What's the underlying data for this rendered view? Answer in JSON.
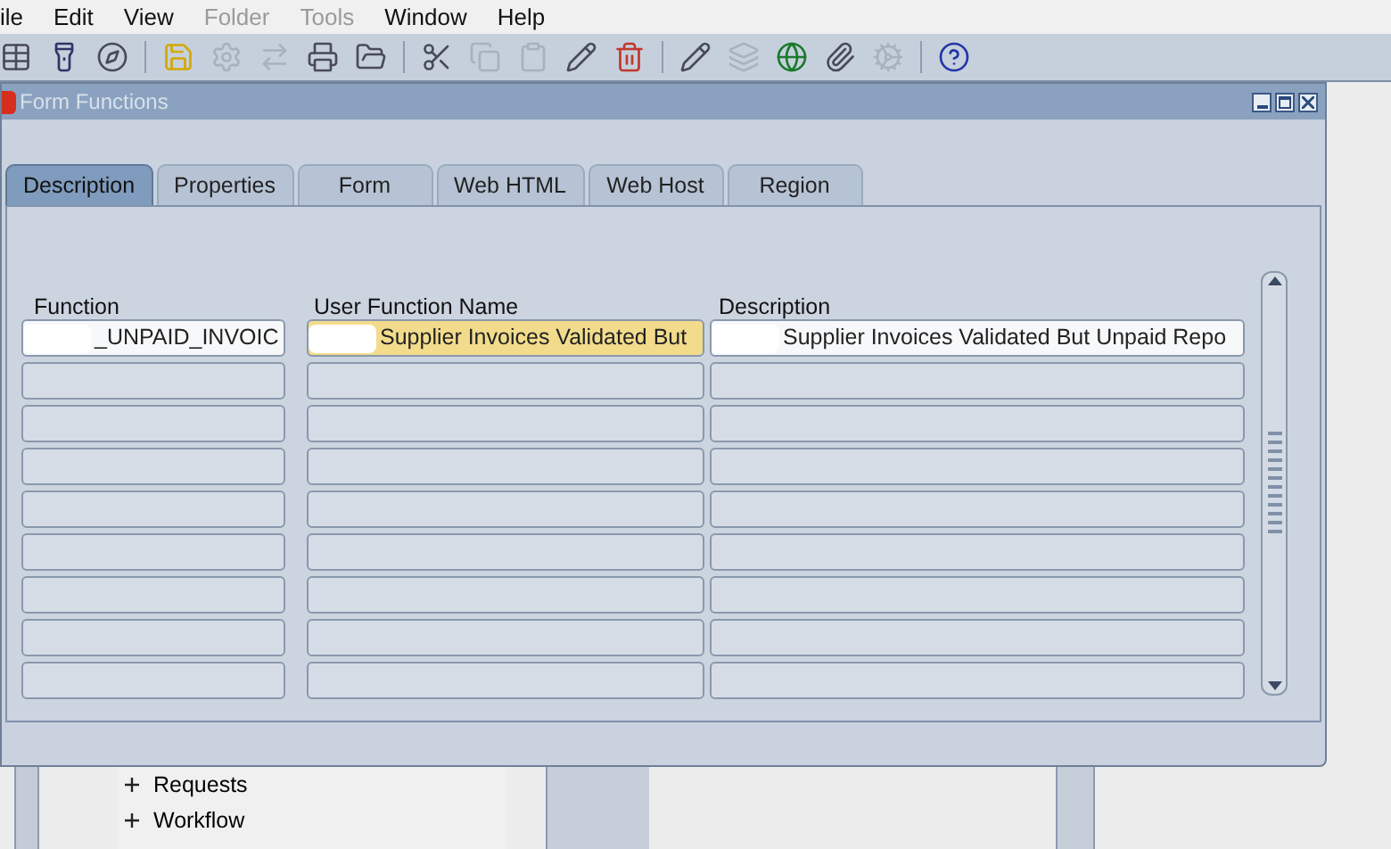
{
  "menu": [
    {
      "label": "ile",
      "disabled": false
    },
    {
      "label": "Edit",
      "disabled": false
    },
    {
      "label": "View",
      "disabled": false
    },
    {
      "label": "Folder",
      "disabled": true
    },
    {
      "label": "Tools",
      "disabled": true
    },
    {
      "label": "Window",
      "disabled": false
    },
    {
      "label": "Help",
      "disabled": false
    }
  ],
  "toolbar": [
    {
      "kind": "new-record",
      "disabled": false
    },
    {
      "kind": "find",
      "disabled": false
    },
    {
      "kind": "navigate",
      "disabled": false
    },
    {
      "kind": "sep"
    },
    {
      "kind": "save",
      "disabled": false
    },
    {
      "kind": "next-step",
      "disabled": true
    },
    {
      "kind": "switch",
      "disabled": true
    },
    {
      "kind": "print",
      "disabled": false
    },
    {
      "kind": "close-form",
      "disabled": false
    },
    {
      "kind": "sep"
    },
    {
      "kind": "cut",
      "disabled": false
    },
    {
      "kind": "copy",
      "disabled": true
    },
    {
      "kind": "paste",
      "disabled": true
    },
    {
      "kind": "edit-record",
      "disabled": false
    },
    {
      "kind": "delete-record",
      "disabled": false
    },
    {
      "kind": "sep"
    },
    {
      "kind": "edit-field",
      "disabled": false
    },
    {
      "kind": "zoom",
      "disabled": true
    },
    {
      "kind": "translate",
      "disabled": false
    },
    {
      "kind": "attach",
      "disabled": false
    },
    {
      "kind": "folder-tools",
      "disabled": true
    },
    {
      "kind": "sep"
    },
    {
      "kind": "help",
      "disabled": false
    }
  ],
  "window": {
    "title": "Form Functions"
  },
  "tabs": [
    {
      "label": "Description",
      "selected": true
    },
    {
      "label": "Properties",
      "selected": false
    },
    {
      "label": "Form",
      "selected": false
    },
    {
      "label": "Web HTML",
      "selected": false
    },
    {
      "label": "Web Host",
      "selected": false
    },
    {
      "label": "Region",
      "selected": false
    }
  ],
  "table": {
    "columns": [
      "Function",
      "User Function Name",
      "Description"
    ],
    "rows": [
      {
        "function": "_UNPAID_INVOIC",
        "user_function_name": "Supplier Invoices Validated But",
        "description": "Supplier Invoices Validated But Unpaid Repo",
        "current": true
      },
      {
        "current": false
      },
      {
        "current": false
      },
      {
        "current": false
      },
      {
        "current": false
      },
      {
        "current": false
      },
      {
        "current": false
      },
      {
        "current": false
      },
      {
        "current": false
      }
    ]
  },
  "navigator": {
    "items": [
      "Requests",
      "Workflow"
    ]
  }
}
